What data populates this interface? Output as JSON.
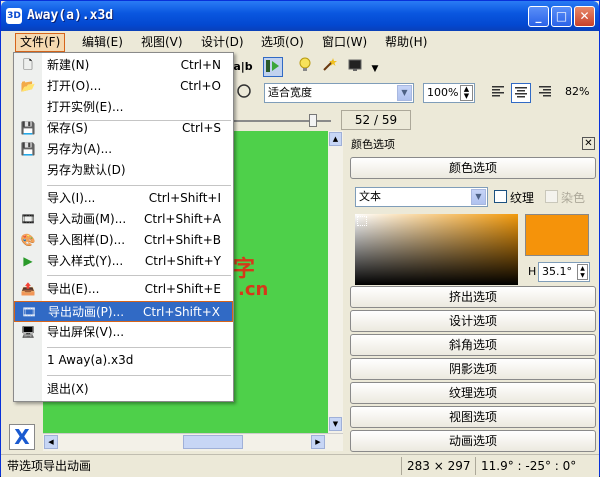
{
  "window": {
    "title": "Away(a).x3d",
    "icon_label": "3D",
    "min_glyph": "_",
    "max_glyph": "□",
    "close_glyph": "✕"
  },
  "menubar": [
    {
      "label": "文件(F)"
    },
    {
      "label": "编辑(E)"
    },
    {
      "label": "视图(V)"
    },
    {
      "label": "设计(D)"
    },
    {
      "label": "选项(O)"
    },
    {
      "label": "窗口(W)"
    },
    {
      "label": "帮助(H)"
    }
  ],
  "toolbar": {
    "text_tool": "a|b",
    "fit_combo": "适合宽度",
    "zoom_value": "100%",
    "right_percent": "82%",
    "page_indicator": "52 / 59"
  },
  "file_menu": {
    "items": [
      {
        "label": "新建(N)",
        "shortcut": "Ctrl+N",
        "icon": "new-file-icon",
        "glyph": "🗋"
      },
      {
        "label": "打开(O)...",
        "shortcut": "Ctrl+O",
        "icon": "open-folder-icon",
        "glyph": "📂"
      },
      {
        "label": "打开实例(E)...",
        "shortcut": "",
        "icon": "",
        "glyph": ""
      },
      {
        "label": "保存(S)",
        "shortcut": "Ctrl+S",
        "icon": "save-icon",
        "glyph": "💾"
      },
      {
        "label": "另存为(A)...",
        "shortcut": "",
        "icon": "save-as-icon",
        "glyph": "💾"
      },
      {
        "label": "另存为默认(D)",
        "shortcut": "",
        "icon": "",
        "glyph": ""
      },
      {
        "label": "导入(I)...",
        "shortcut": "Ctrl+Shift+I",
        "icon": "",
        "glyph": ""
      },
      {
        "label": "导入动画(M)...",
        "shortcut": "Ctrl+Shift+A",
        "icon": "import-animation-icon",
        "glyph": "🎞"
      },
      {
        "label": "导入图样(D)...",
        "shortcut": "Ctrl+Shift+B",
        "icon": "import-pattern-icon",
        "glyph": "🎨"
      },
      {
        "label": "导入样式(Y)...",
        "shortcut": "Ctrl+Shift+Y",
        "icon": "import-style-icon",
        "glyph": "▶"
      },
      {
        "label": "导出(E)...",
        "shortcut": "Ctrl+Shift+E",
        "icon": "export-icon",
        "glyph": "📤"
      },
      {
        "label": "导出动画(P)...",
        "shortcut": "Ctrl+Shift+X",
        "icon": "export-animation-icon",
        "glyph": "🎞"
      },
      {
        "label": "导出屏保(V)...",
        "shortcut": "",
        "icon": "export-screensaver-icon",
        "glyph": "🖥"
      },
      {
        "label": "1 Away(a).x3d",
        "shortcut": "",
        "icon": "",
        "glyph": ""
      },
      {
        "label": "退出(X)",
        "shortcut": "",
        "icon": "",
        "glyph": ""
      }
    ]
  },
  "panel": {
    "title": "颜色选项",
    "close_glyph": "✕",
    "header_button": "颜色选项",
    "text_combo": "文本",
    "texture_label": "纹理",
    "dye_label": "染色",
    "angle_prefix": "H",
    "angle_value": "35.1°",
    "sections": [
      "挤出选项",
      "设计选项",
      "斜角选项",
      "阴影选项",
      "纹理选项",
      "视图选项",
      "动画选项"
    ],
    "swatch_color": "#f5930a"
  },
  "canvas": {
    "bg_color": "#4ed04a",
    "watermark_char": "字",
    "watermark_domain": ".cn"
  },
  "status": {
    "message": "带选项导出动画",
    "size": "283 × 297",
    "angles": "11.9° : -25° : 0°"
  }
}
